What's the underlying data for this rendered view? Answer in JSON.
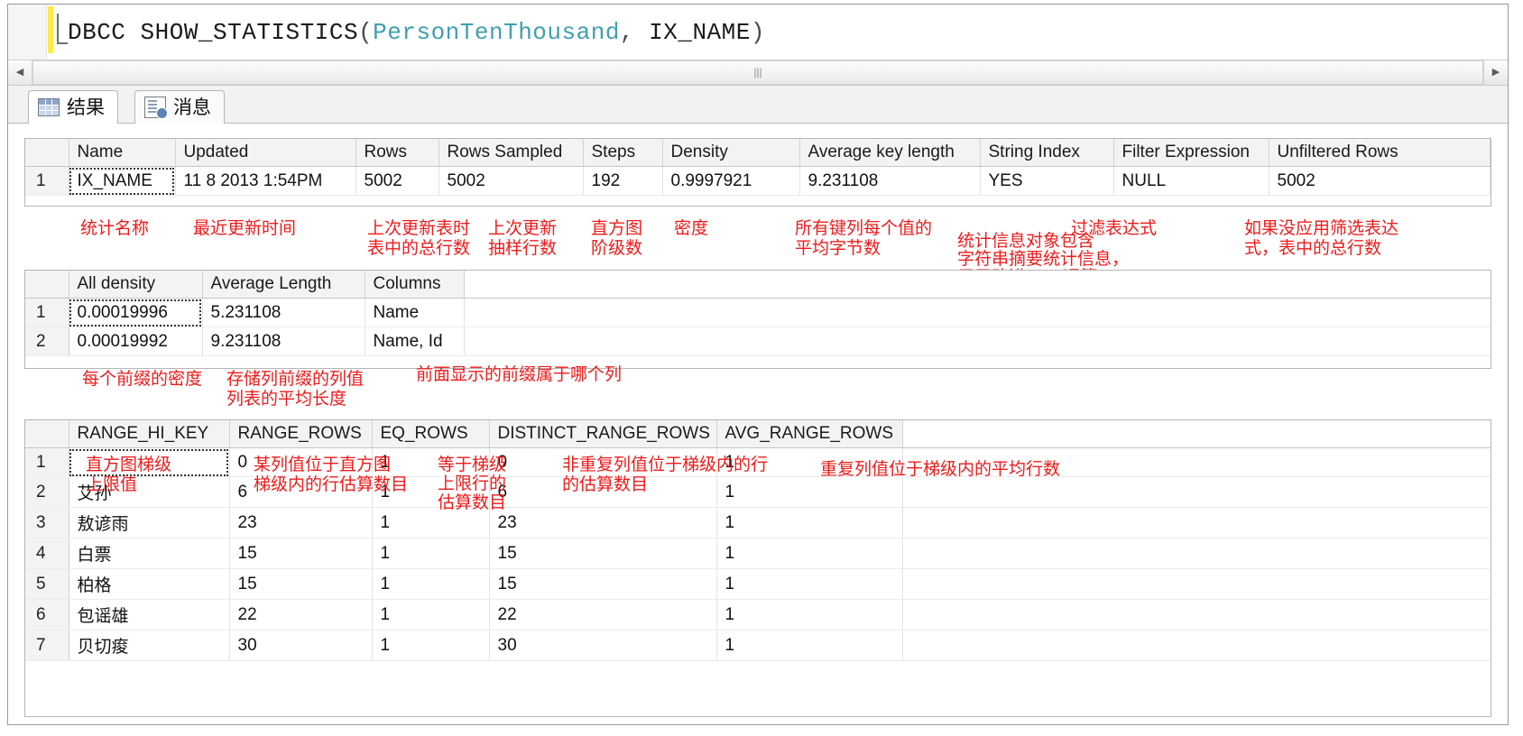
{
  "editor": {
    "query_keyword": "DBCC SHOW_STATISTICS",
    "query_open_paren": "(",
    "query_arg1": "PersonTenThousand",
    "query_comma": ", ",
    "query_arg2": "IX_NAME",
    "query_close_paren": ")",
    "scroll_left_arrow": "◀",
    "scroll_right_arrow": "▶",
    "scroll_thumb_grip": "|||"
  },
  "tabs": [
    {
      "label": "结果",
      "icon": "results-grid-icon",
      "active": true
    },
    {
      "label": "消息",
      "icon": "messages-doc-icon",
      "active": false
    }
  ],
  "grid1": {
    "headers": [
      "",
      "Name",
      "Updated",
      "Rows",
      "Rows Sampled",
      "Steps",
      "Density",
      "Average key length",
      "String Index",
      "Filter Expression",
      "Unfiltered Rows"
    ],
    "rows": [
      {
        "num": "1",
        "name": "IX_NAME",
        "updated": "11  8 2013  1:54PM",
        "rows": "5002",
        "rows_sampled": "5002",
        "steps": "192",
        "density": "0.9997921",
        "avg_key_length": "9.231108",
        "string_index": "YES",
        "filter_expression": "NULL",
        "unfiltered_rows": "5002"
      }
    ],
    "notes": [
      "统计名称",
      "最近更新时间",
      "上次更新表时\n表中的总行数",
      "上次更新\n抽样行数",
      "直方图\n阶级数",
      "密度",
      "所有键列每个值的\n平均字节数",
      "统计信息对象包含\n字符串摘要统计信息，\n用于改进LIKE运算",
      "过滤表达式",
      "如果没应用筛选表达\n式，表中的总行数"
    ]
  },
  "grid2": {
    "headers": [
      "",
      "All density",
      "Average Length",
      "Columns"
    ],
    "rows": [
      {
        "num": "1",
        "all_density": "0.00019996",
        "average_length": "5.231108",
        "columns": "Name"
      },
      {
        "num": "2",
        "all_density": "0.00019992",
        "average_length": "9.231108",
        "columns": "Name, Id"
      }
    ],
    "notes": [
      "每个前缀的密度",
      "存储列前缀的列值\n列表的平均长度",
      "前面显示的前缀属于哪个列"
    ]
  },
  "grid3": {
    "headers": [
      "",
      "RANGE_HI_KEY",
      "RANGE_ROWS",
      "EQ_ROWS",
      "DISTINCT_RANGE_ROWS",
      "AVG_RANGE_ROWS"
    ],
    "rows": [
      {
        "num": "1",
        "range_hi_key": "",
        "range_rows": "0",
        "eq_rows": "1",
        "distinct_range_rows": "0",
        "avg_range_rows": "1"
      },
      {
        "num": "2",
        "range_hi_key": "艾孙",
        "range_rows": "6",
        "eq_rows": "1",
        "distinct_range_rows": "6",
        "avg_range_rows": "1"
      },
      {
        "num": "3",
        "range_hi_key": "敖谚雨",
        "range_rows": "23",
        "eq_rows": "1",
        "distinct_range_rows": "23",
        "avg_range_rows": "1"
      },
      {
        "num": "4",
        "range_hi_key": "白票",
        "range_rows": "15",
        "eq_rows": "1",
        "distinct_range_rows": "15",
        "avg_range_rows": "1"
      },
      {
        "num": "5",
        "range_hi_key": "柏格",
        "range_rows": "15",
        "eq_rows": "1",
        "distinct_range_rows": "15",
        "avg_range_rows": "1"
      },
      {
        "num": "6",
        "range_hi_key": "包谣雄",
        "range_rows": "22",
        "eq_rows": "1",
        "distinct_range_rows": "22",
        "avg_range_rows": "1"
      },
      {
        "num": "7",
        "range_hi_key": "贝切痠",
        "range_rows": "30",
        "eq_rows": "1",
        "distinct_range_rows": "30",
        "avg_range_rows": "1"
      }
    ],
    "notes": [
      "直方图梯级\n上限值",
      "某列值位于直方图\n梯级内的行估算数目",
      "等于梯级\n上限行的\n估算数目",
      "非重复列值位于梯级内的行\n的估算数目",
      "重复列值位于梯级内的平均行数"
    ]
  },
  "colors": {
    "annotation_red": "#ee1b1b",
    "identifier_teal": "#3f9fb0",
    "highlight_yellow": "#fdfbe0",
    "selection_blue": "#dbe6f2"
  }
}
